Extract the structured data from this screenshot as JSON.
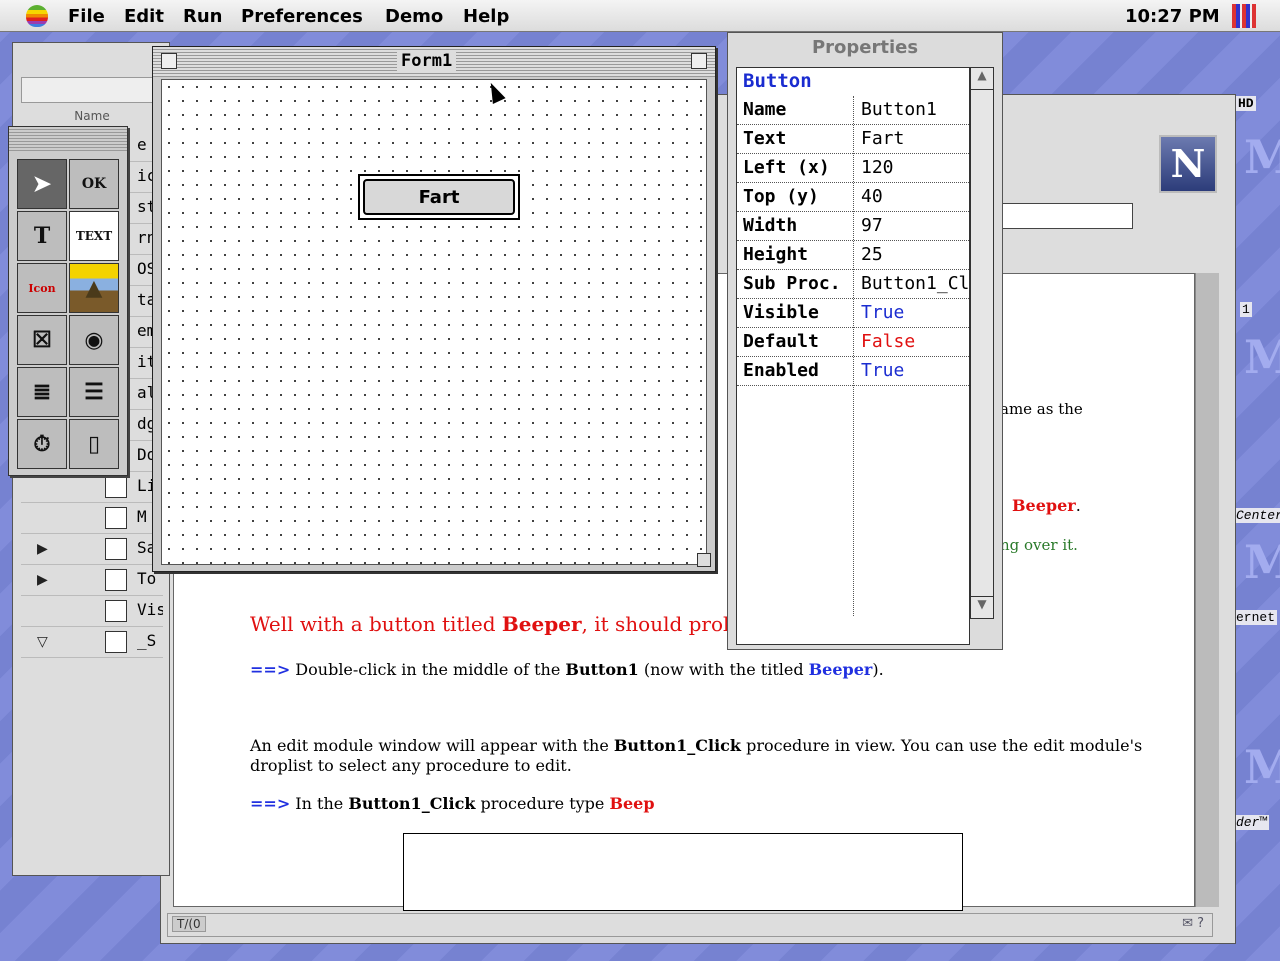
{
  "menubar": {
    "items": [
      "File",
      "Edit",
      "Run",
      "Preferences",
      "Demo",
      "Help"
    ],
    "clock": "10:27 PM"
  },
  "desktop": {
    "hd_label": "HD",
    "side_labels": [
      "1",
      "Center",
      "ernet",
      "der™"
    ]
  },
  "form1": {
    "title": "Form1",
    "button_label": "Fart"
  },
  "properties": {
    "header": "Properties",
    "object_type": "Button",
    "rows": [
      {
        "key": "Name",
        "value": "Button1",
        "color": "#000000"
      },
      {
        "key": "Text",
        "value": "Fart",
        "color": "#000000"
      },
      {
        "key": "Left (x)",
        "value": "120",
        "color": "#000000"
      },
      {
        "key": "Top (y)",
        "value": "40",
        "color": "#000000"
      },
      {
        "key": "Width",
        "value": "97",
        "color": "#000000"
      },
      {
        "key": "Height",
        "value": "25",
        "color": "#000000"
      },
      {
        "key": "Sub Proc.",
        "value": "Button1_Cl",
        "color": "#000000"
      },
      {
        "key": "Visible",
        "value": "True",
        "color": "#1a2cd0"
      },
      {
        "key": "Default",
        "value": "False",
        "color": "#e01010"
      },
      {
        "key": "Enabled",
        "value": "True",
        "color": "#1a2cd0"
      }
    ]
  },
  "palette": {
    "tools": [
      "pointer-tool",
      "ok-button-tool",
      "label-tool",
      "text-field-tool",
      "icon-tool",
      "picture-tool",
      "checkbox-tool",
      "radio-tool",
      "list-tool",
      "popup-tool",
      "timer-tool",
      "scrollbar-tool"
    ],
    "ok_text": "OK",
    "text_text": "TEXT",
    "icon_text": "Icon"
  },
  "listwin": {
    "name_header": "Name",
    "rows": [
      {
        "tri": "",
        "text": "e E"
      },
      {
        "tri": "",
        "text": "ica"
      },
      {
        "tri": "",
        "text": "sta"
      },
      {
        "tri": "",
        "text": "rne"
      },
      {
        "tri": "",
        "text": "OS"
      },
      {
        "tri": "",
        "text": "ta\\"
      },
      {
        "tri": "",
        "text": "em"
      },
      {
        "tri": "",
        "text": "itie"
      },
      {
        "tri": "",
        "text": "al"
      },
      {
        "tri": "",
        "text": "dg"
      },
      {
        "tri": "",
        "text": "Do"
      },
      {
        "tri": "",
        "text": "Li"
      },
      {
        "tri": "",
        "text": "M"
      },
      {
        "tri": "▶",
        "text": "Sa"
      },
      {
        "tri": "▶",
        "text": "To"
      },
      {
        "tri": "",
        "text": "Vis"
      },
      {
        "tri": "▽",
        "text": "_S"
      }
    ]
  },
  "browser": {
    "status_left": "T/(0",
    "status_right": "✉ ?",
    "frag_right1": "ame as the",
    "frag_right2": "Beeper",
    "frag_right3": "ng over it.",
    "p1_a": "Well with a button titled ",
    "p1_b": "Beeper",
    "p1_c": ", it should probably",
    "p2_arrow": "==>",
    "p2_a": " Double-click in the middle of the ",
    "p2_b": "Button1",
    "p2_c": " (now with the titled ",
    "p2_d": "Beeper",
    "p2_e": ").",
    "p3_a": "An edit module window will appear with the ",
    "p3_b": "Button1_Click",
    "p3_c": " procedure in view. You can use the edit module's",
    "p3_d": "droplist to select any procedure to edit.",
    "p4_arrow": "==>",
    "p4_a": " In the ",
    "p4_b": "Button1_Click",
    "p4_c": " procedure type ",
    "p4_d": "Beep"
  }
}
